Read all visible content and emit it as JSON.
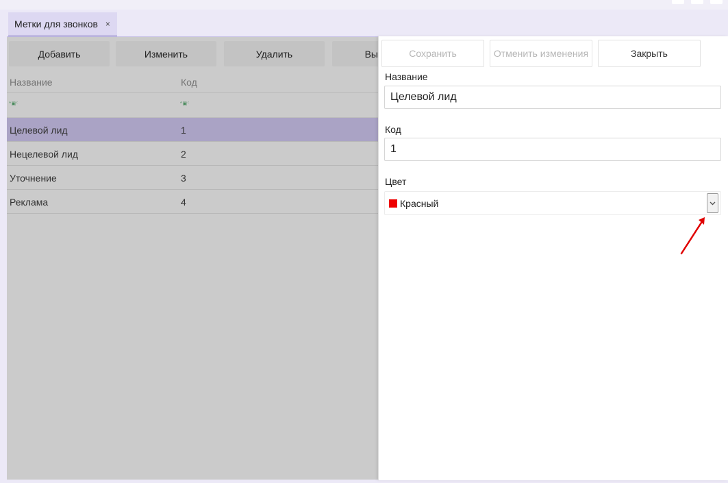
{
  "colors": {
    "accent": "#7b6fb9",
    "selected_row": "#aaa3c5",
    "swatch_red": "#ee0000",
    "annotation_arrow": "#e00000"
  },
  "tab": {
    "label": "Метки для звонков",
    "close": "×"
  },
  "toolbar": {
    "add": "Добавить",
    "edit": "Изменить",
    "delete": "Удалить",
    "partial": "Вы"
  },
  "grid": {
    "columns": [
      "Название",
      "Код"
    ],
    "filter_icon": "abc-filter-icon",
    "rows": [
      {
        "name": "Целевой лид",
        "code": "1",
        "selected": true
      },
      {
        "name": "Нецелевой лид",
        "code": "2",
        "selected": false
      },
      {
        "name": "Уточнение",
        "code": "3",
        "selected": false
      },
      {
        "name": "Реклама",
        "code": "4",
        "selected": false
      }
    ]
  },
  "panel": {
    "save": "Сохранить",
    "cancel": "Отменить изменения",
    "close": "Закрыть",
    "name_label": "Название",
    "name_value": "Целевой лид",
    "code_label": "Код",
    "code_value": "1",
    "color_label": "Цвет",
    "color_value": "Красный",
    "dropdown_icon": "chevron-down-icon"
  }
}
